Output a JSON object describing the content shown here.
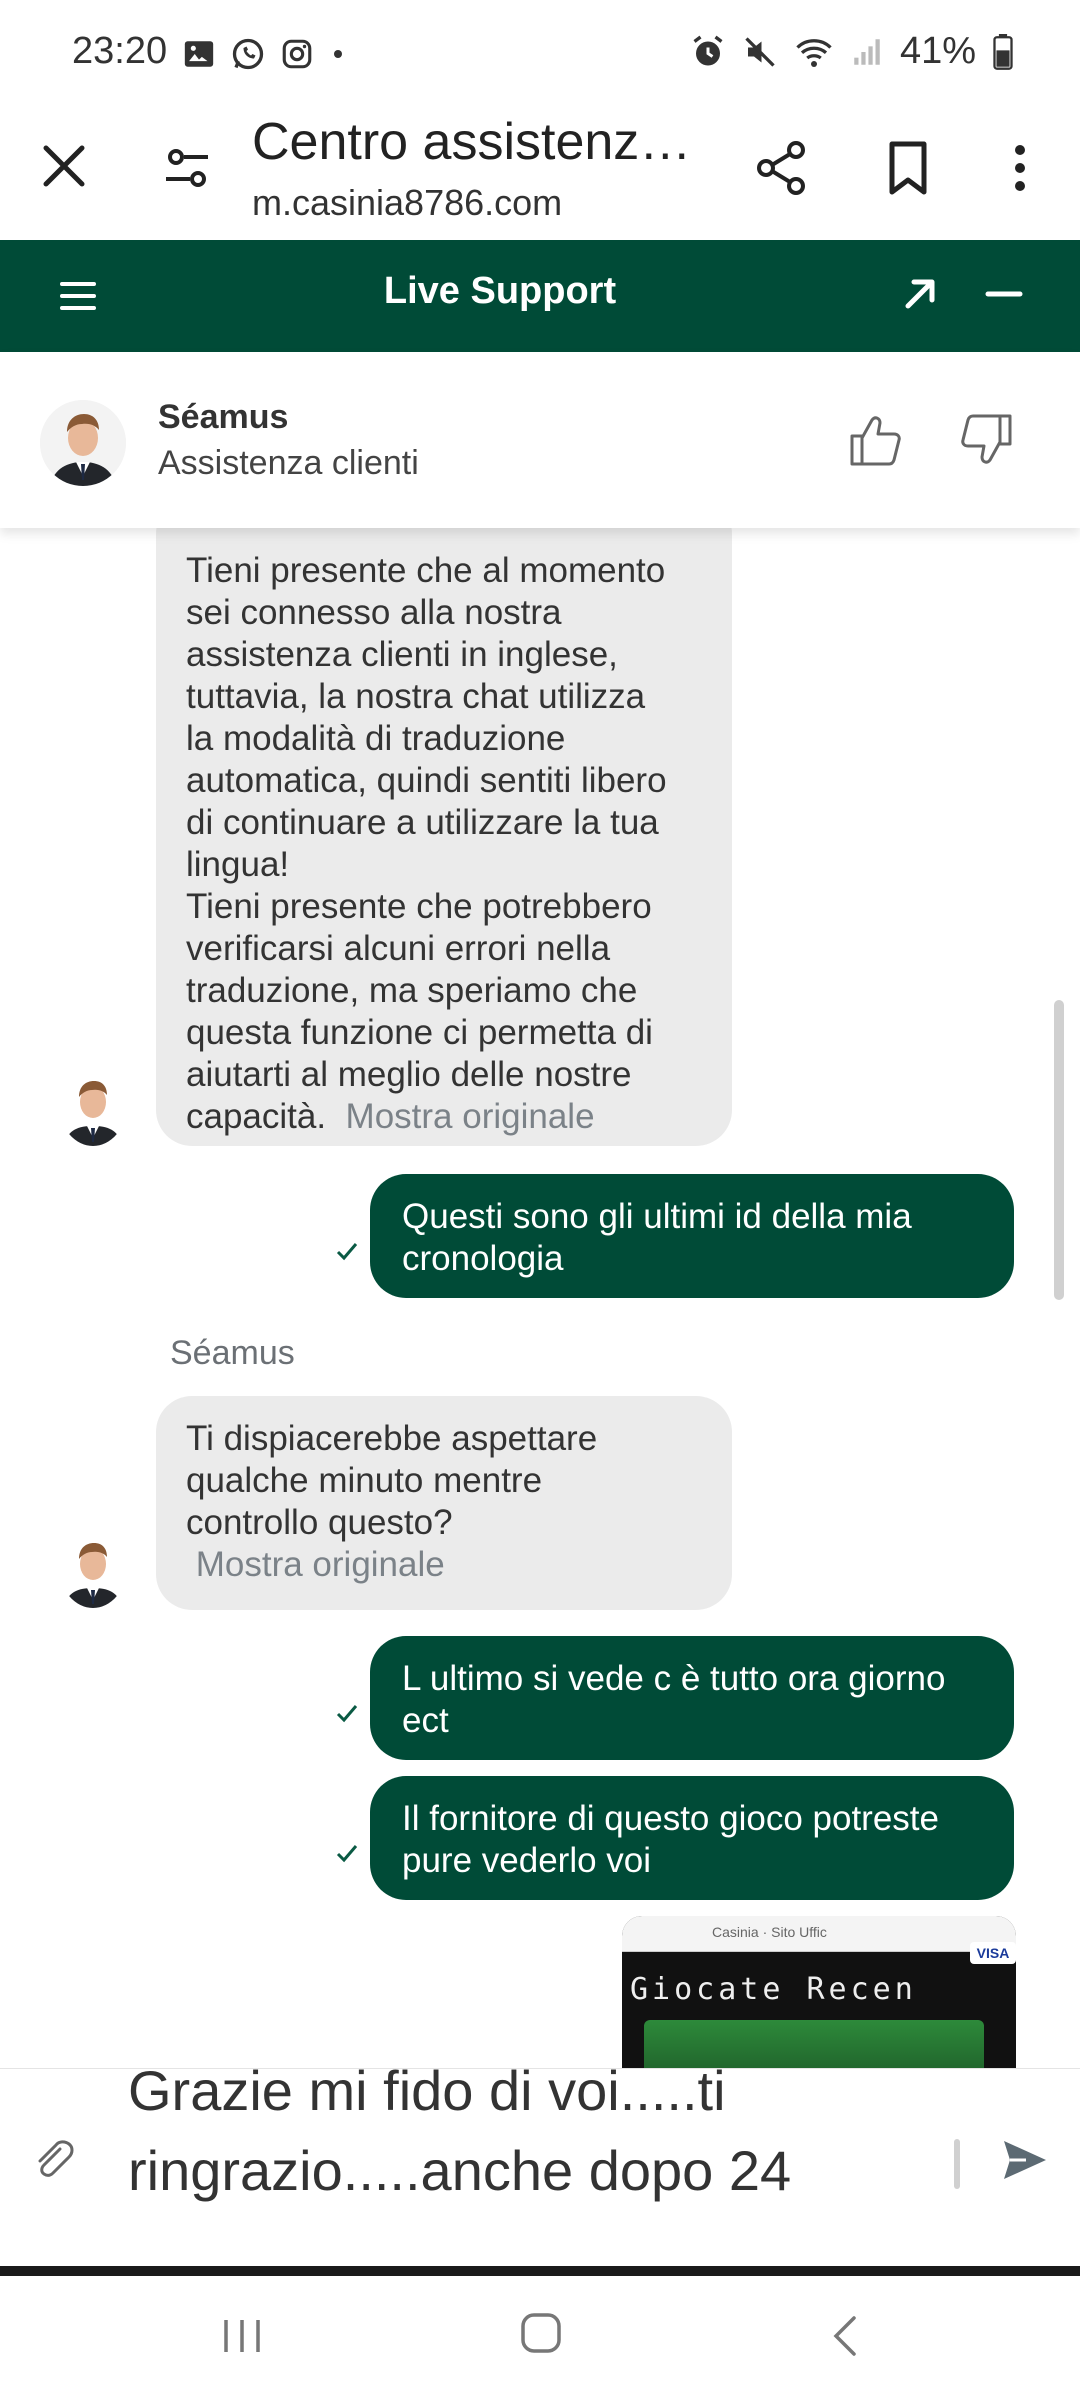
{
  "status_bar": {
    "time": "23:20",
    "battery": "41%"
  },
  "browser": {
    "title": "Centro assistenz…",
    "url": "m.casinia8786.com"
  },
  "support_header": {
    "title": "Live Support"
  },
  "agent": {
    "name": "Séamus",
    "role": "Assistenza clienti"
  },
  "messages": {
    "agent_1": {
      "lines": [
        "Tieni presente che al momento",
        "sei connesso alla nostra",
        "assistenza clienti in inglese,",
        "tuttavia, la nostra chat utilizza",
        "la modalità di traduzione",
        "automatica, quindi sentiti libero",
        "di continuare a utilizzare la tua",
        "lingua!",
        "Tieni presente che potrebbero",
        "verificarsi alcuni errori nella",
        "traduzione, ma speriamo che",
        "questa funzione ci permetta di",
        "aiutarti al meglio delle nostre"
      ],
      "last_line": "capacità.",
      "show_original": "Mostra originale"
    },
    "user_1": {
      "lines": [
        "Questi sono gli ultimi id della mia",
        "cronologia"
      ]
    },
    "sender_label": "Séamus",
    "agent_2": {
      "lines": [
        "Ti dispiacerebbe aspettare",
        "qualche minuto mentre",
        "controllo questo?"
      ],
      "show_original": "Mostra originale"
    },
    "user_2": {
      "lines": [
        "L ultimo si vede c è tutto ora giorno",
        "ect"
      ]
    },
    "user_3": {
      "lines": [
        "Il fornitore di questo gioco potreste",
        "pure vederlo voi"
      ]
    },
    "image_preview": {
      "header": "Casinia · Sito Uffic",
      "banner": "Giocate Recen",
      "badge": "VISA"
    }
  },
  "composer": {
    "line1": "Grazie mi fido di voi.....ti",
    "line2": "ringrazio.....anche dopo 24"
  },
  "colors": {
    "brand_green": "#004b37",
    "agent_bubble": "#ebebeb"
  }
}
